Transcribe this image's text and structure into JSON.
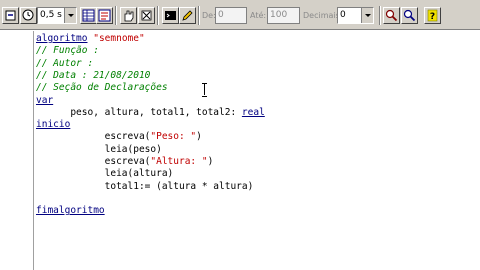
{
  "toolbar": {
    "speed_value": "0,5 s",
    "de_label": "De:",
    "de_value": "0",
    "ate_label": "Até:",
    "ate_value": "100",
    "decimais_label": "Decimais",
    "decimais_value": "0"
  },
  "editor": {
    "lines": [
      [
        {
          "t": "algoritmo",
          "c": "kw"
        },
        {
          "t": " "
        },
        {
          "t": "\"semnome\"",
          "c": "str"
        }
      ],
      [
        {
          "t": "// Função :",
          "c": "cm"
        }
      ],
      [
        {
          "t": "// Autor :",
          "c": "cm"
        }
      ],
      [
        {
          "t": "// Data : 21/08/2010",
          "c": "cm"
        }
      ],
      [
        {
          "t": "// Seção de Declarações",
          "c": "cm"
        }
      ],
      [
        {
          "t": "var",
          "c": "kw"
        }
      ],
      [
        {
          "t": "      peso, altura, total1, total2: "
        },
        {
          "t": "real",
          "c": "kw"
        }
      ],
      [
        {
          "t": "inicio",
          "c": "kw"
        }
      ],
      [
        {
          "t": "            escreva("
        },
        {
          "t": "\"Peso: \"",
          "c": "str"
        },
        {
          "t": ")"
        }
      ],
      [
        {
          "t": "            leia(peso)"
        }
      ],
      [
        {
          "t": "            escreva("
        },
        {
          "t": "\"Altura: \"",
          "c": "str"
        },
        {
          "t": ")"
        }
      ],
      [
        {
          "t": "            leia(altura)"
        }
      ],
      [
        {
          "t": "            total1:= (altura * altura)"
        }
      ],
      [
        {
          "t": ""
        }
      ],
      [
        {
          "t": "fimalgoritmo",
          "c": "kw"
        }
      ]
    ]
  }
}
